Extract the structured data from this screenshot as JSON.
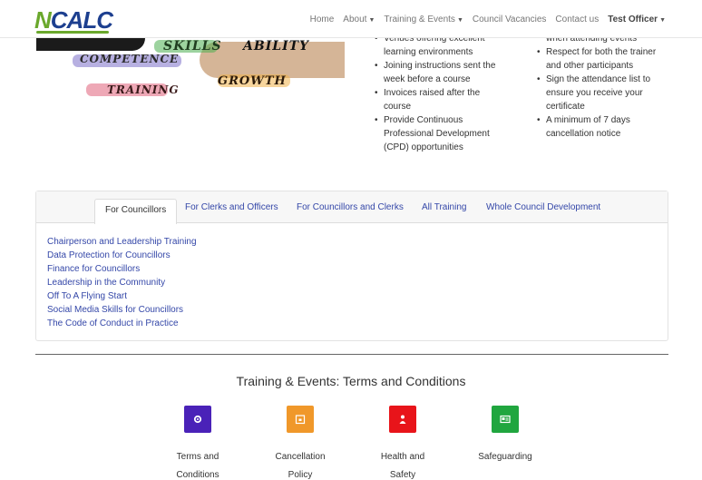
{
  "header": {
    "logo_n": "N",
    "logo_rest": "CALC",
    "nav": {
      "home": "Home",
      "about": "About",
      "training": "Training & Events",
      "vacancies": "Council Vacancies",
      "contact": "Contact us",
      "user": "Test Officer"
    }
  },
  "hero": {
    "words": [
      "SKILLS",
      "ABILITY",
      "COMPETENCE",
      "TRAINING",
      "GROWTH"
    ]
  },
  "bullets": {
    "left": [
      "Venues offering excellent learning environments",
      "Joining instructions sent the week before a course",
      "Invoices raised after the course",
      "Provide Continuous Professional Development (CPD) opportunities"
    ],
    "right": [
      "when attending events",
      "Respect for both the trainer and other participants",
      "Sign the attendance list to ensure you receive your certificate",
      "A minimum of 7 days cancellation notice"
    ]
  },
  "tabs": [
    "For Councillors",
    "For Clerks and Officers",
    "For Councillors and Clerks",
    "All Training",
    "Whole Council Development"
  ],
  "active_tab": "For Councillors",
  "courses": [
    "Chairperson and Leadership Training",
    "Data Protection for Councillors",
    "Finance for Councillors",
    "Leadership in the Community",
    "Off To A Flying Start",
    "Social Media Skills for Councillors",
    "The Code of Conduct in Practice"
  ],
  "terms": {
    "title": "Training & Events: Terms and Conditions",
    "cards": [
      {
        "line1": "Terms and",
        "line2": "Conditions",
        "color": "#4a22b8",
        "icon": "gear-icon"
      },
      {
        "line1": "Cancellation",
        "line2": "Policy",
        "color": "#f0982a",
        "icon": "calendar-icon"
      },
      {
        "line1": "Health and",
        "line2": "Safety",
        "color": "#e8141a",
        "icon": "person-icon"
      },
      {
        "line1": "Safeguarding",
        "line2": "",
        "color": "#20a63f",
        "icon": "id-card-icon"
      }
    ]
  }
}
